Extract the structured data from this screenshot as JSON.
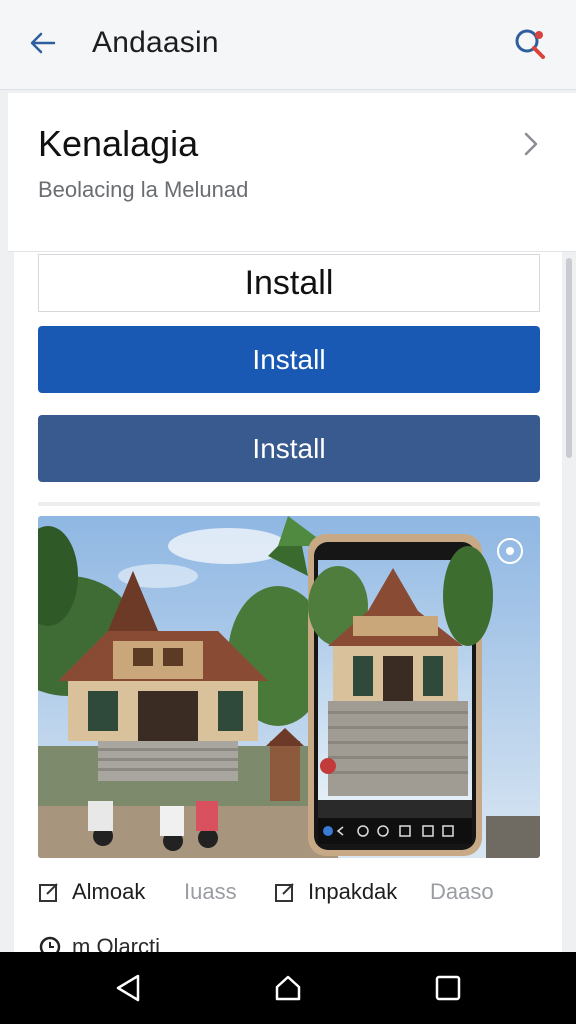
{
  "topbar": {
    "title": "Andaasin",
    "back_icon": "arrow-left-icon",
    "search_icon": "search-icon"
  },
  "header": {
    "app_name": "Kenalagia",
    "subtitle": "Beolacing la Melunad",
    "chevron_icon": "chevron-right-icon"
  },
  "buttons": {
    "install_outline": "Install",
    "install_primary": "Install",
    "install_secondary": "Install"
  },
  "tags": [
    {
      "label": "Almoak",
      "icon": "edit-icon"
    },
    {
      "label": "Iuass"
    },
    {
      "label": "Inpakdak",
      "icon": "edit-icon"
    },
    {
      "label": "Daaso"
    }
  ],
  "partial_row": {
    "label": "m Olarcti",
    "icon": "clock-icon"
  },
  "colors": {
    "primary": "#1a59b3",
    "secondary": "#385a8e",
    "accent_red": "#d8433b"
  },
  "navbar": {
    "back": "nav-back-icon",
    "home": "nav-home-icon",
    "recents": "nav-recents-icon"
  }
}
